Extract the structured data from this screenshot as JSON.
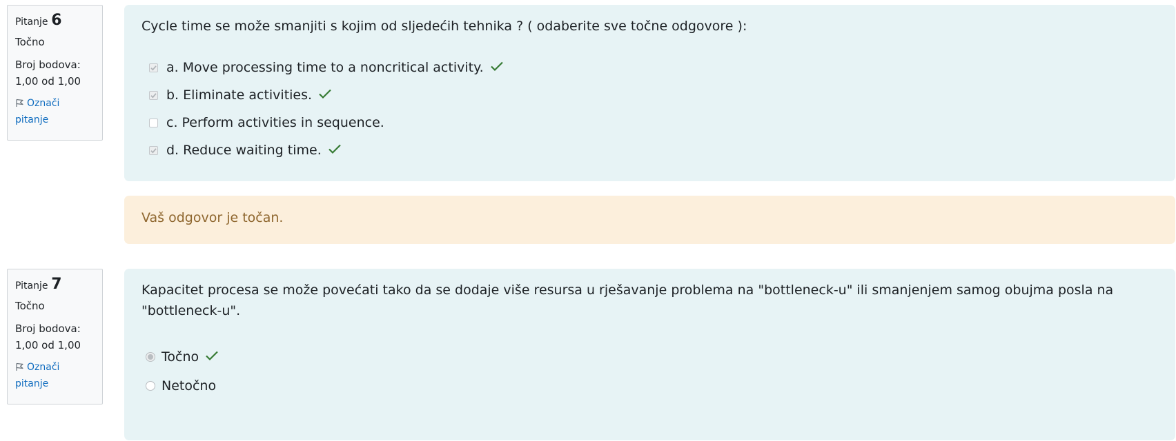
{
  "q6": {
    "label": "Pitanje",
    "number": "6",
    "state": "Točno",
    "grade_label": "Broj bodova:",
    "grade_value": "1,00 od 1,00",
    "flag_line1": "Označi",
    "flag_line2": "pitanje",
    "text": "Cycle time se može smanjiti s kojim od sljedećih tehnika ? ( odaberite sve točne odgovore ):",
    "answers": [
      {
        "text": "a. Move processing time to a noncritical activity.",
        "checked": true,
        "correct": true
      },
      {
        "text": "b. Eliminate activities.",
        "checked": true,
        "correct": true
      },
      {
        "text": "c. Perform activities in sequence.",
        "checked": false,
        "correct": false
      },
      {
        "text": "d. Reduce waiting time.",
        "checked": true,
        "correct": true
      }
    ],
    "feedback": "Vaš odgovor je točan."
  },
  "q7": {
    "label": "Pitanje",
    "number": "7",
    "state": "Točno",
    "grade_label": "Broj bodova:",
    "grade_value": "1,00 od 1,00",
    "flag_line1": "Označi",
    "flag_line2": "pitanje",
    "text_line1": "Kapacitet procesa se može povećati tako da se dodaje više resursa u rješavanje problema na \"bottleneck-u\" ili smanjenjem samog obujma posla na",
    "text_line2": "\"bottleneck-u\".",
    "options": [
      {
        "text": "Točno",
        "selected": true,
        "correct": true
      },
      {
        "text": "Netočno",
        "selected": false,
        "correct": false
      }
    ]
  },
  "colors": {
    "tick": "#357a32",
    "link": "#0f6cbf",
    "feedback_text": "#8e662e",
    "feedback_bg": "#fcefdc",
    "formulation_bg": "#e7f3f5"
  },
  "icons": {
    "flag": "flag-icon",
    "check": "check-icon"
  }
}
